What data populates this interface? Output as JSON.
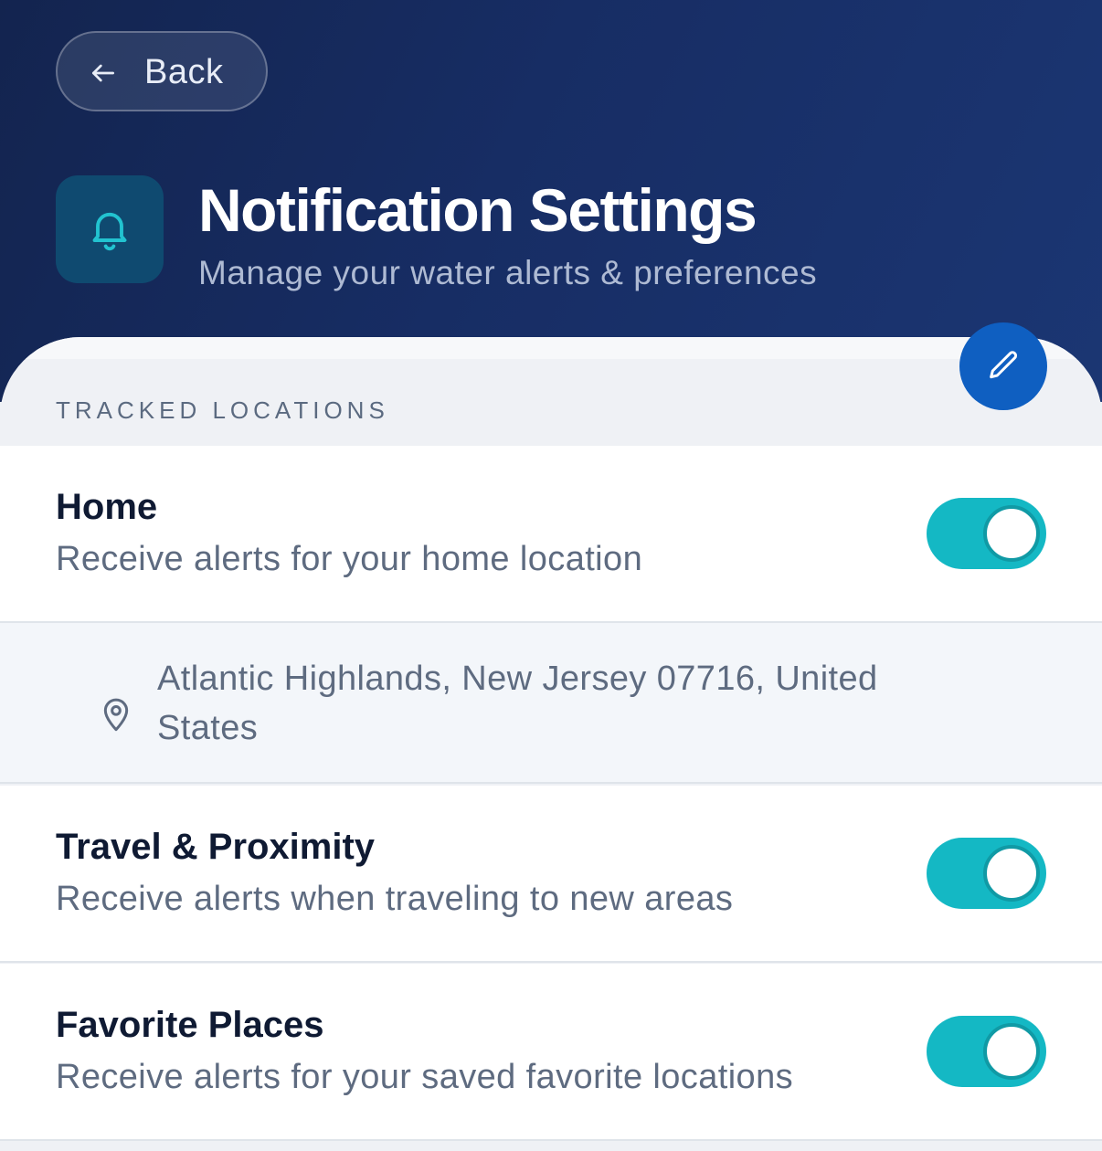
{
  "header": {
    "back_label": "Back",
    "title": "Notification Settings",
    "subtitle": "Manage your water alerts & preferences",
    "icon": "bell-icon"
  },
  "section": {
    "label": "TRACKED LOCATIONS"
  },
  "locations": [
    {
      "title": "Home",
      "description": "Receive alerts for your home location",
      "enabled": true
    },
    {
      "title": "Travel & Proximity",
      "description": "Receive alerts when traveling to new areas",
      "enabled": true
    },
    {
      "title": "Favorite Places",
      "description": "Receive alerts for your saved favorite locations",
      "enabled": true
    }
  ],
  "home_address": {
    "text": "Atlantic Highlands, New Jersey 07716, United States",
    "icon": "map-pin-icon",
    "edit_icon": "pencil-icon"
  },
  "colors": {
    "header_bg": "#172d64",
    "toggle_on": "#14b8c4",
    "edit_button": "#0f5fc1",
    "bell_tile": "#0f4a70"
  }
}
